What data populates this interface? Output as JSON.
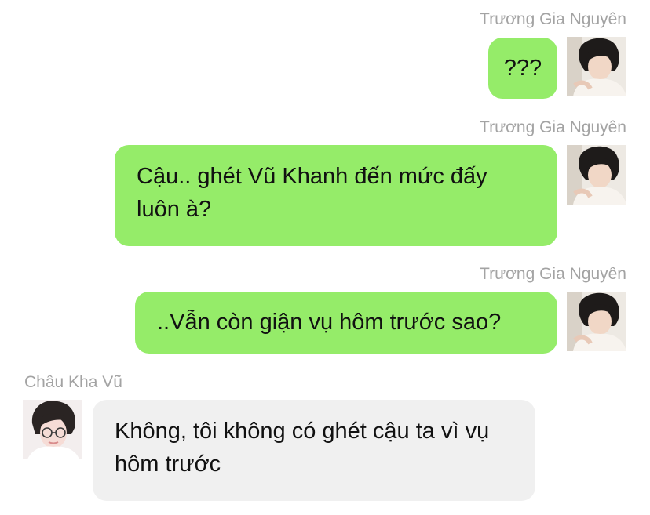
{
  "chat": {
    "messages": [
      {
        "sender": "Trương Gia Nguyên",
        "side": "right",
        "text": "???",
        "avatar_icon": "avatar-icon"
      },
      {
        "sender": "Trương Gia Nguyên",
        "side": "right",
        "text": "Cậu.. ghét Vũ Khanh đến mức đấy luôn à?",
        "avatar_icon": "avatar-icon"
      },
      {
        "sender": "Trương Gia Nguyên",
        "side": "right",
        "text": "..Vẫn còn giận vụ hôm trước sao?",
        "avatar_icon": "avatar-icon"
      },
      {
        "sender": "Châu Kha Vũ",
        "side": "left",
        "text": "Không, tôi không có ghét cậu ta vì vụ hôm trước",
        "avatar_icon": "avatar-icon"
      }
    ]
  },
  "colors": {
    "outgoing_bubble": "#95ec69",
    "incoming_bubble": "#f0f0f0",
    "sender_name": "#a3a3a3",
    "text": "#111111"
  }
}
